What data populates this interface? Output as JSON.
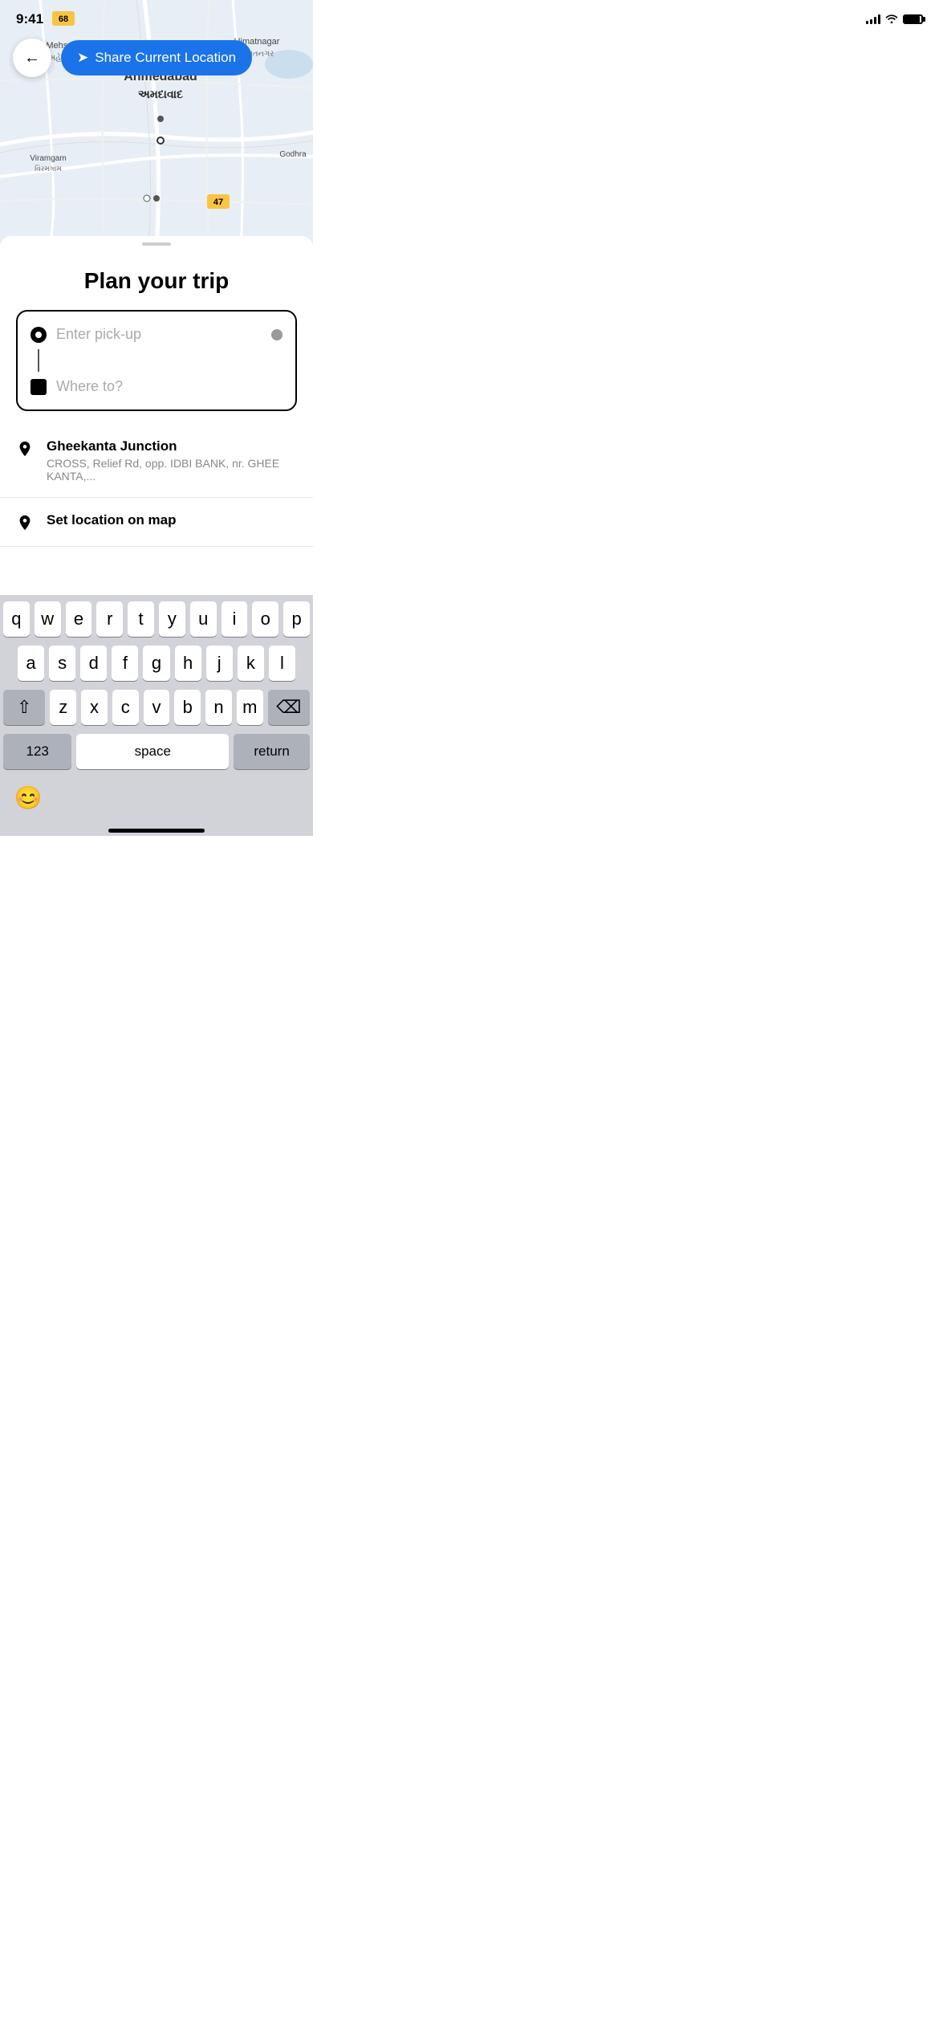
{
  "statusBar": {
    "time": "9:41",
    "signalBars": [
      4,
      6,
      8,
      10,
      12
    ],
    "wifiLabel": "wifi",
    "batteryLevel": 90
  },
  "mapTopBar": {
    "backLabel": "←",
    "shareButtonLabel": "Share Current Location",
    "shareButtonIcon": "➤"
  },
  "content": {
    "title": "Plan your trip",
    "pickupPlaceholder": "Enter pick-up",
    "destinationPlaceholder": "Where to?"
  },
  "suggestions": [
    {
      "name": "Gheekanta Junction",
      "address": "CROSS, Relief Rd, opp. IDBI BANK, nr. GHEE KANTA,..."
    }
  ],
  "setLocationLabel": "Set location on map",
  "keyboard": {
    "rows": [
      [
        "q",
        "w",
        "e",
        "r",
        "t",
        "y",
        "u",
        "i",
        "o",
        "p"
      ],
      [
        "a",
        "s",
        "d",
        "f",
        "g",
        "h",
        "j",
        "k",
        "l"
      ],
      [
        "z",
        "x",
        "c",
        "v",
        "b",
        "n",
        "m"
      ]
    ],
    "spaceLabel": "space",
    "returnLabel": "return",
    "numbersLabel": "123",
    "shiftIcon": "⇧",
    "deleteIcon": "⌫",
    "emojiIcon": "😊"
  }
}
